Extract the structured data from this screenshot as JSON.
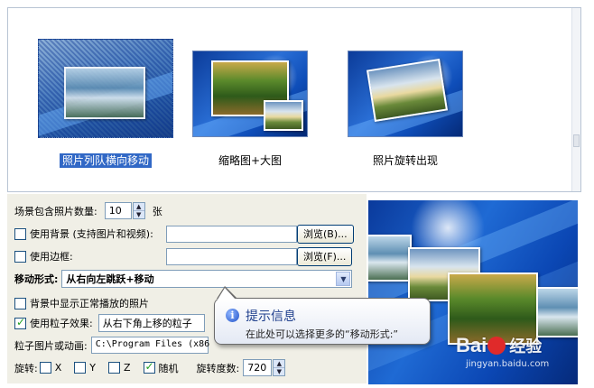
{
  "gallery": {
    "items": [
      {
        "label": "照片列队横向移动",
        "selected": true
      },
      {
        "label": "缩略图+大图",
        "selected": false
      },
      {
        "label": "照片旋转出现",
        "selected": false
      }
    ]
  },
  "form": {
    "photo_count_label": "场景包含照片数量:",
    "photo_count_value": "10",
    "photo_count_unit": "张",
    "use_background_label": "使用背景 (支持图片和视频):",
    "use_background_value": "",
    "use_border_label": "使用边框:",
    "use_border_value": "",
    "browse_b_label": "浏览(B)...",
    "browse_f_label": "浏览(F)...",
    "move_style_label": "移动形式:",
    "move_style_value": "从右向左跳跃+移动",
    "show_bg_photos_label": "背景中显示正常播放的照片",
    "use_particles_label": "使用粒子效果:",
    "particles_value": "从右下角上移的粒子",
    "particle_image_label": "粒子图片或动画:",
    "particle_image_value": "C:\\Program Files (x86",
    "rotate_label": "旋转:",
    "rotate_x": "X",
    "rotate_y": "Y",
    "rotate_z": "Z",
    "rotate_random": "随机",
    "rotate_degrees_label": "旋转度数:",
    "rotate_degrees_value": "720"
  },
  "states": {
    "use_background": false,
    "use_border": false,
    "show_bg_photos": false,
    "use_particles": true,
    "rotate_x": false,
    "rotate_y": false,
    "rotate_z": false,
    "rotate_random": true
  },
  "tooltip": {
    "title": "提示信息",
    "body": "在此处可以选择更多的“移动形式:”"
  },
  "watermark": {
    "brand": "Bai",
    "brand_suffix": "经验",
    "url": "jingyan.baidu.com"
  },
  "icons": [
    "info-icon",
    "spin-up-icon",
    "spin-down-icon",
    "dropdown-arrow-icon",
    "baidu-paw-icon",
    "checkmark-icon"
  ],
  "colors": {
    "selection": "#3168c6",
    "tooltip_title": "#1e3e8c",
    "panel": "#f0efe6"
  }
}
